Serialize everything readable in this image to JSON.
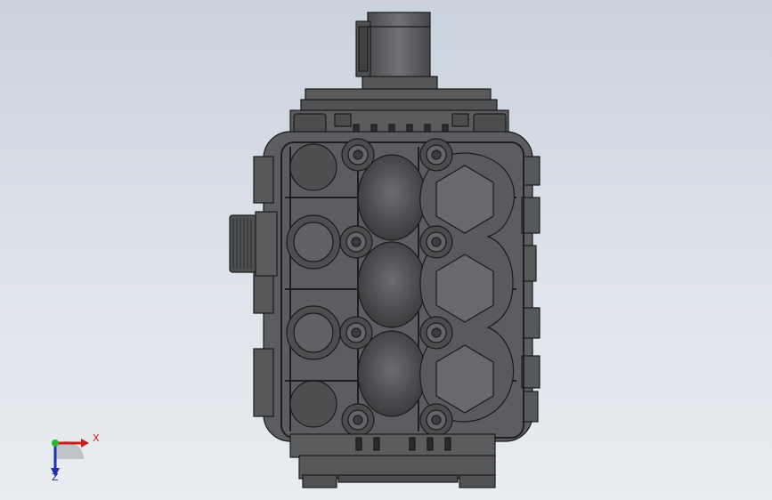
{
  "viewport": {
    "background_top": "#c9d2dd",
    "background_bottom": "#e9edf1",
    "model_color": "#5c5e61"
  },
  "triad": {
    "x_label": "X",
    "z_label": "Z",
    "x_color": "#cc1d1d",
    "y_color": "#2bb52b",
    "z_color": "#1f2fb0"
  }
}
